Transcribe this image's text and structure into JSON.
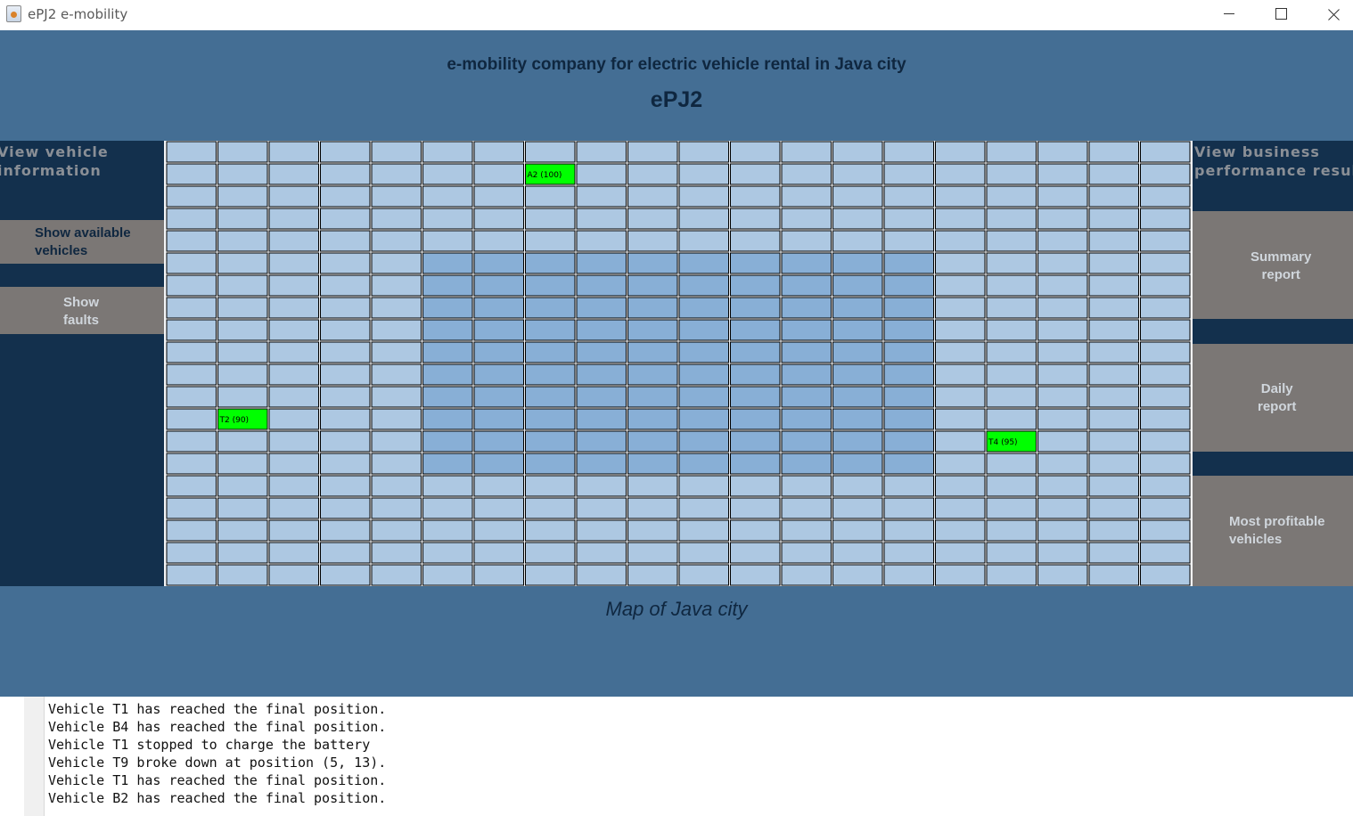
{
  "window": {
    "title": "ePJ2 e-mobility",
    "icon": "java-cup-icon"
  },
  "header": {
    "subtitle": "e-mobility company for electric vehicle rental in Java city",
    "app_name": "ePJ2"
  },
  "left_panel": {
    "heading": "View vehicle\ninformation",
    "buttons": {
      "available": "Show available\nvehicles",
      "faults": "Show\nfaults"
    }
  },
  "right_panel": {
    "heading": "View business\nperformance results",
    "buttons": {
      "summary": "Summary\nreport",
      "daily": "Daily\nreport",
      "profitable": "Most profitable\nvehicles"
    }
  },
  "map": {
    "caption": "Map of Java city",
    "columns": 20,
    "rows": 20,
    "center_zone": {
      "col_start": 5,
      "col_end": 14,
      "row_start": 5,
      "row_end": 14
    },
    "vehicles": [
      {
        "label": "A2 (100)",
        "col": 7,
        "row": 1
      },
      {
        "label": "T2 (90)",
        "col": 1,
        "row": 12
      },
      {
        "label": "T4 (95)",
        "col": 16,
        "row": 13
      }
    ]
  },
  "colors": {
    "frame": "#446e94",
    "panel": "#13304d",
    "button": "#7b7775",
    "cell_outer": "#adc8e2",
    "cell_center": "#88afd6",
    "vehicle": "#00ff00"
  },
  "log": {
    "lines": [
      "Vehicle T1 has reached the final position.",
      "Vehicle B4 has reached the final position.",
      "Vehicle T1 stopped to charge the battery",
      "Vehicle T9 broke down at position (5, 13).",
      "Vehicle T1 has reached the final position.",
      "Vehicle B2 has reached the final position."
    ]
  }
}
